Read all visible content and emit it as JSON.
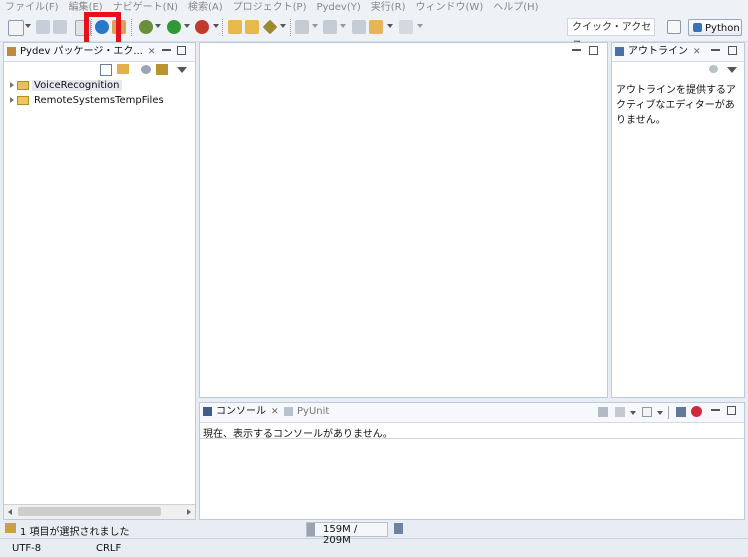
{
  "menu": [
    "ファイル(F)",
    "編集(E)",
    "ナビゲート(N)",
    "検索(A)",
    "プロジェクト(P)",
    "Pydev(Y)",
    "実行(R)",
    "ウィンドウ(W)",
    "ヘルプ(H)"
  ],
  "toolbar": {
    "quick_access": "クイック・アクセス",
    "perspective_label": "Python",
    "highlight_color": "#e8101a"
  },
  "package_explorer": {
    "tab_label": "Pydev パッケージ・エク...",
    "items": [
      {
        "label": "VoiceRecognition",
        "selected": true
      },
      {
        "label": "RemoteSystemsTempFiles",
        "selected": false
      }
    ]
  },
  "outline": {
    "tab_label": "アウトライン",
    "message": "アウトラインを提供するアクティブなエディターがありません。"
  },
  "console": {
    "tab_console": "コンソール",
    "tab_pyunit": "PyUnit",
    "message": "現在、表示するコンソールがありません。"
  },
  "status": {
    "selection": "1 項目が選択されました",
    "memory": "159M / 209M",
    "encoding": "UTF-8",
    "line_delimiter": "CRLF"
  }
}
